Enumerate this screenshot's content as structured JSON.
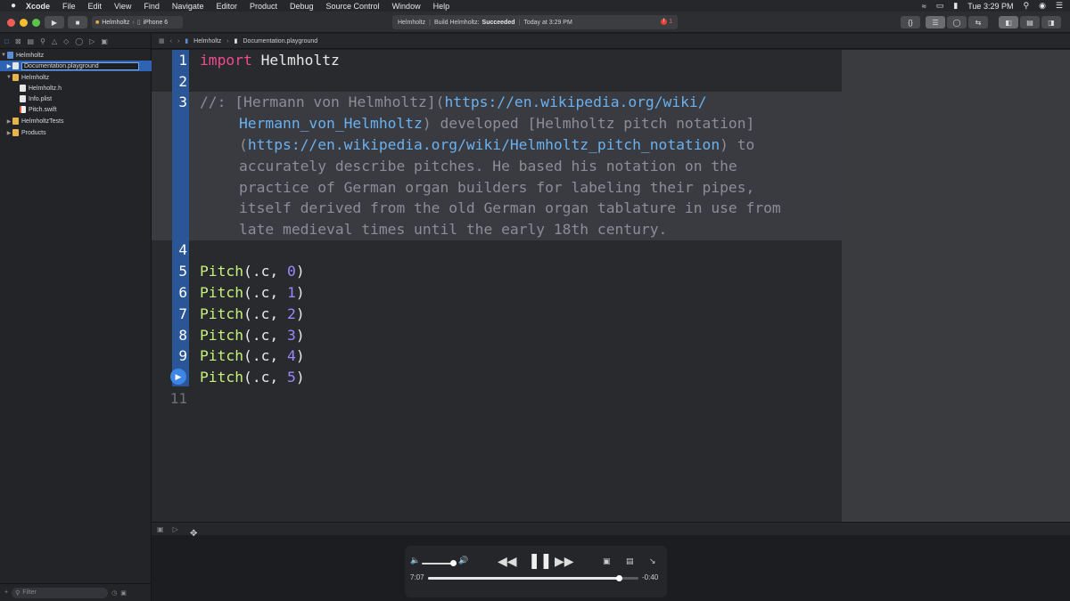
{
  "menubar": {
    "apple": "",
    "app": "Xcode",
    "items": [
      "File",
      "Edit",
      "View",
      "Find",
      "Navigate",
      "Editor",
      "Product",
      "Debug",
      "Source Control",
      "Window",
      "Help"
    ],
    "clock": "Tue 3:29 PM"
  },
  "toolbar": {
    "scheme": "Helmholtz",
    "device": "iPhone 6",
    "activity_project": "Helmholtz",
    "activity_status_prefix": "Build Helmholtz:",
    "activity_status": "Succeeded",
    "activity_time": "Today at 3:29 PM",
    "error_count": "1"
  },
  "navigator": {
    "project": "Helmholtz",
    "rename_value": "Documentation.playground",
    "folder": "Helmholtz",
    "files": [
      "Helmholtz.h",
      "Info.plist",
      "Pitch.swift"
    ],
    "tests": "HelmholtzTests",
    "products": "Products",
    "filter_placeholder": "Filter"
  },
  "jumpbar": {
    "crumb1": "Helmholtz",
    "crumb2": "Documentation.playground"
  },
  "editor": {
    "line_numbers": [
      "1",
      "2",
      "3",
      "4",
      "5",
      "6",
      "7",
      "8",
      "9",
      "11"
    ],
    "line1_kw": "import",
    "line1_rest": " Helmholtz",
    "doc": {
      "l1_a": "//: [Hermann von Helmholtz](",
      "l1_link": "https://en.wikipedia.org/wiki/",
      "l2_link": "Hermann_von_Helmholtz",
      "l2_b": ") developed [Helmholtz pitch notation]",
      "l3_a": "(",
      "l3_link": "https://en.wikipedia.org/wiki/Helmholtz_pitch_notation",
      "l3_b": ") to",
      "l4": "accurately describe pitches. He based his notation on the",
      "l5": "practice of German organ builders for labeling their pipes,",
      "l6": "itself derived from the old German organ tablature in use from",
      "l7": "late medieval times until the early 18th century."
    },
    "pitch_fn": "Pitch",
    "pitch_args": [
      ".c, ",
      ".c, ",
      ".c, ",
      ".c, ",
      ".c, ",
      ".c, "
    ],
    "pitch_nums": [
      "0",
      "1",
      "2",
      "3",
      "4",
      "5"
    ]
  },
  "player": {
    "elapsed": "7:07",
    "remaining": "-0:40",
    "progress": 0.905,
    "volume": 0.85
  }
}
